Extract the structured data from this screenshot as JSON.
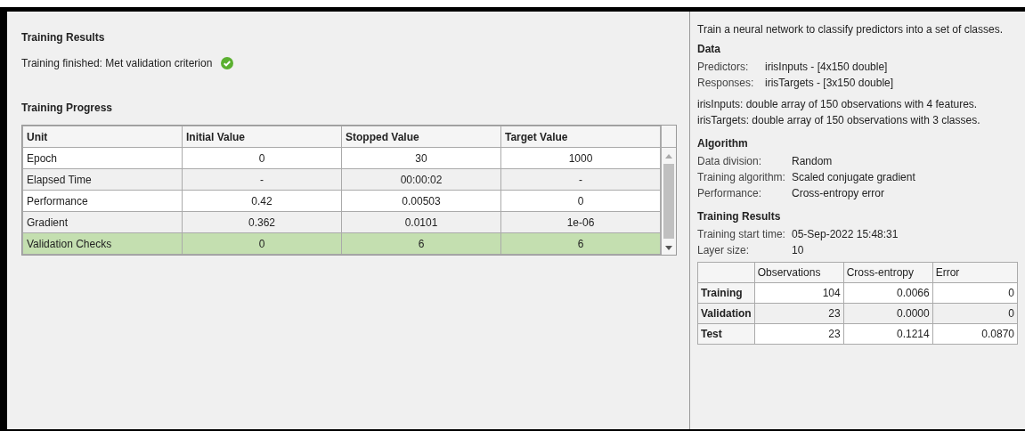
{
  "results": {
    "title": "Training Results",
    "status": "Training finished: Met validation criterion",
    "status_ok": true
  },
  "progress": {
    "title": "Training Progress",
    "columns": [
      "Unit",
      "Initial Value",
      "Stopped Value",
      "Target Value"
    ],
    "rows": [
      {
        "cells": [
          "Epoch",
          "0",
          "30",
          "1000"
        ],
        "highlighted": false
      },
      {
        "cells": [
          "Elapsed Time",
          "-",
          "00:00:02",
          "-"
        ],
        "highlighted": false
      },
      {
        "cells": [
          "Performance",
          "0.42",
          "0.00503",
          "0"
        ],
        "highlighted": false
      },
      {
        "cells": [
          "Gradient",
          "0.362",
          "0.0101",
          "1e-06"
        ],
        "highlighted": false
      },
      {
        "cells": [
          "Validation Checks",
          "0",
          "6",
          "6"
        ],
        "highlighted": true
      }
    ]
  },
  "info": {
    "description": "Train a neural network to classify predictors into a set of classes.",
    "data": {
      "title": "Data",
      "fields": [
        {
          "label": "Predictors:",
          "value": "irisInputs - [4x150 double]"
        },
        {
          "label": "Responses:",
          "value": "irisTargets - [3x150 double]"
        }
      ],
      "notes": [
        "irisInputs: double array of 150 observations with 4 features.",
        "irisTargets: double array of 150 observations with 3 classes."
      ]
    },
    "algorithm": {
      "title": "Algorithm",
      "fields": [
        {
          "label": "Data division:",
          "value": "Random"
        },
        {
          "label": "Training algorithm:",
          "value": "Scaled conjugate gradient"
        },
        {
          "label": "Performance:",
          "value": "Cross-entropy error"
        }
      ]
    },
    "training_results": {
      "title": "Training Results",
      "fields": [
        {
          "label": "Training start time:",
          "value": "05-Sep-2022 15:48:31"
        },
        {
          "label": "Layer size:",
          "value": "10"
        }
      ],
      "table": {
        "columns": [
          "Observations",
          "Cross-entropy",
          "Error"
        ],
        "rows": [
          {
            "label": "Training",
            "cells": [
              "104",
              "0.0066",
              "0"
            ]
          },
          {
            "label": "Validation",
            "cells": [
              "23",
              "0.0000",
              "0"
            ]
          },
          {
            "label": "Test",
            "cells": [
              "23",
              "0.1214",
              "0.0870"
            ]
          }
        ]
      }
    }
  }
}
